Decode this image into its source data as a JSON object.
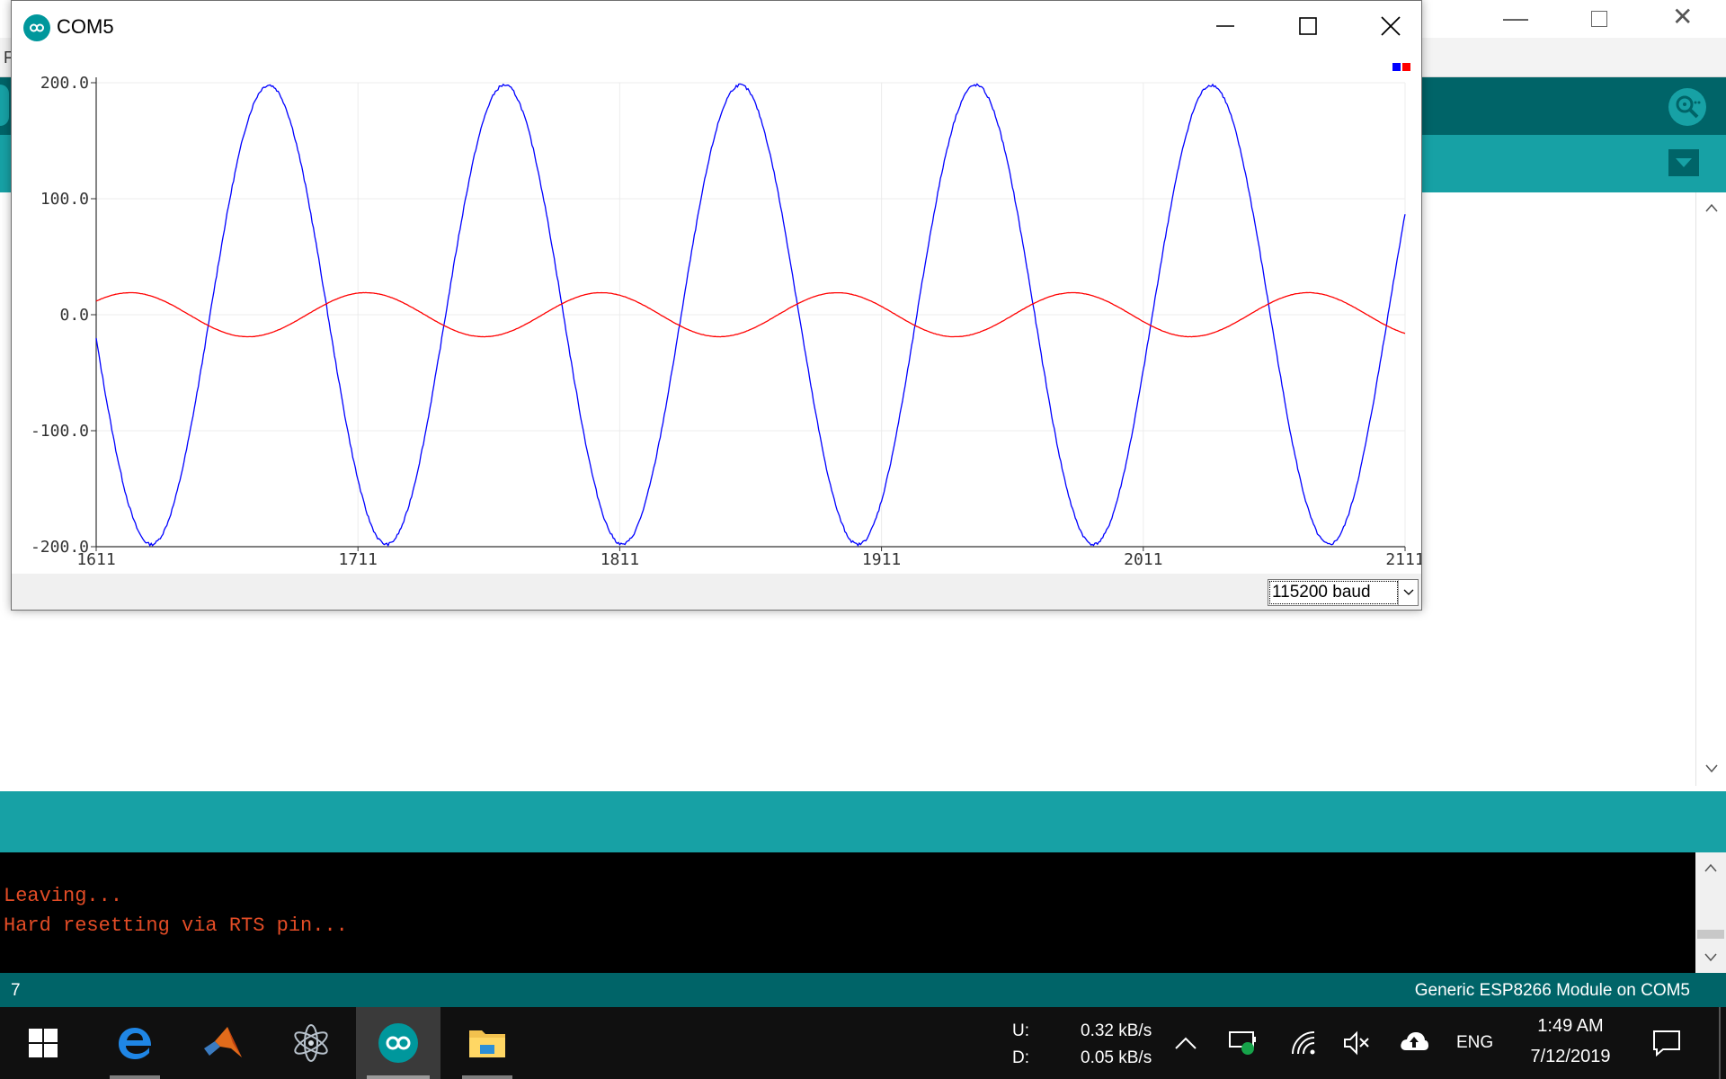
{
  "ide": {
    "menu_fragment": "F",
    "console_lines": [
      "Leaving...",
      "Hard resetting via RTS pin..."
    ],
    "status": {
      "line_number": "7",
      "board": "Generic ESP8266 Module on COM5"
    }
  },
  "plotter": {
    "window_title": "COM5",
    "baud_rate": "115200 baud",
    "legend_colors": [
      "#0000ff",
      "#ff0000"
    ]
  },
  "chart_data": {
    "type": "line",
    "title": "",
    "xlabel": "",
    "ylabel": "",
    "x_ticks": [
      "1611",
      "1711",
      "1811",
      "1911",
      "2011",
      "2111"
    ],
    "y_ticks": [
      "200.0",
      "100.0",
      "0.0",
      "-100.0",
      "-200.0"
    ],
    "xlim": [
      1611,
      2111
    ],
    "ylim": [
      -200,
      200
    ],
    "grid": true,
    "legend": "top-right",
    "series": [
      {
        "color": "#0000ff",
        "shape": "sine",
        "amplitude": 198,
        "period": 90,
        "peak_x": [
          1677,
          1766,
          1855,
          1945,
          2034
        ],
        "trough_x": [
          1632,
          1721,
          1811,
          1900,
          1989,
          2079
        ],
        "start_y": -50,
        "end_y": 122
      },
      {
        "color": "#ff0000",
        "shape": "sine",
        "amplitude": 19,
        "period": 90,
        "peak_x": [
          1624,
          1713,
          1803,
          1893,
          1982,
          2071
        ],
        "trough_x": [
          1669,
          1758,
          1848,
          1937,
          2026
        ],
        "start_y": 12,
        "end_y": -15
      }
    ]
  },
  "taskbar": {
    "net_up_label": "U:",
    "net_up_value": "0.32 kB/s",
    "net_down_label": "D:",
    "net_down_value": "0.05 kB/s",
    "language": "ENG",
    "time": "1:49 AM",
    "date": "7/12/2019",
    "apps": [
      "start-icon",
      "edge-icon",
      "matlab-icon",
      "atom-icon",
      "arduino-icon",
      "file-explorer-icon"
    ]
  }
}
